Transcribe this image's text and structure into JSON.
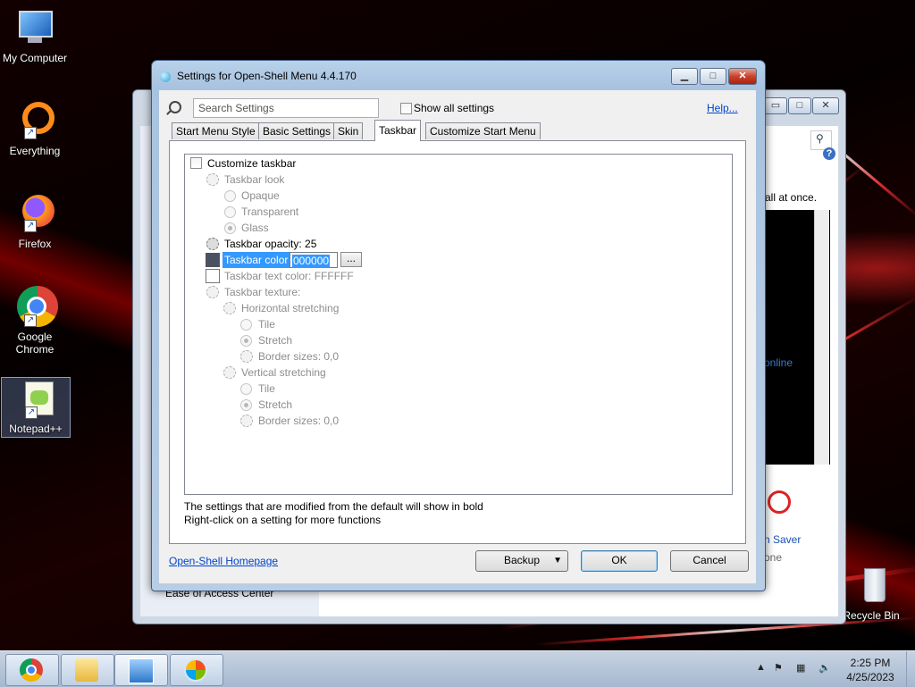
{
  "desktop_icons": [
    {
      "label": "My Computer"
    },
    {
      "label": "Everything"
    },
    {
      "label": "Firefox"
    },
    {
      "label": "Google Chrome"
    },
    {
      "label": "Notepad++"
    },
    {
      "label": "Recycle Bin"
    }
  ],
  "background_window": {
    "visible_text_right": "all at once.",
    "link_text": "online",
    "screensaver_label": "n Saver",
    "none_label": "one",
    "left_item": "Ease of Access Center"
  },
  "dialog": {
    "title": "Settings for Open-Shell Menu 4.4.170",
    "search_placeholder": "Search Settings",
    "show_all_label": "Show all settings",
    "help_label": "Help...",
    "tabs": [
      {
        "label": "Start Menu Style"
      },
      {
        "label": "Basic Settings"
      },
      {
        "label": "Skin"
      },
      {
        "label": "Taskbar"
      },
      {
        "label": "Customize Start Menu"
      }
    ],
    "active_tab": "Taskbar",
    "settings": {
      "customize_taskbar": "Customize taskbar",
      "taskbar_look": "Taskbar look",
      "opaque": "Opaque",
      "transparent": "Transparent",
      "glass": "Glass",
      "taskbar_opacity": "Taskbar opacity: 25",
      "taskbar_color": "Taskbar color",
      "taskbar_color_value": "000000",
      "dots": "...",
      "taskbar_text_color": "Taskbar text color: FFFFFF",
      "taskbar_texture": "Taskbar texture:",
      "horizontal_stretching": "Horizontal stretching",
      "tile_h": "Tile",
      "stretch_h": "Stretch",
      "border_sizes_h": "Border sizes: 0,0",
      "vertical_stretching": "Vertical stretching",
      "tile_v": "Tile",
      "stretch_v": "Stretch",
      "border_sizes_v": "Border sizes: 0,0"
    },
    "note_line1": "The settings that are modified from the default will show in bold",
    "note_line2": "Right-click on a setting for more functions",
    "homepage_link": "Open-Shell Homepage",
    "backup_label": "Backup",
    "ok_label": "OK",
    "cancel_label": "Cancel"
  },
  "taskbar": {
    "time": "2:25 PM",
    "date": "4/25/2023"
  }
}
